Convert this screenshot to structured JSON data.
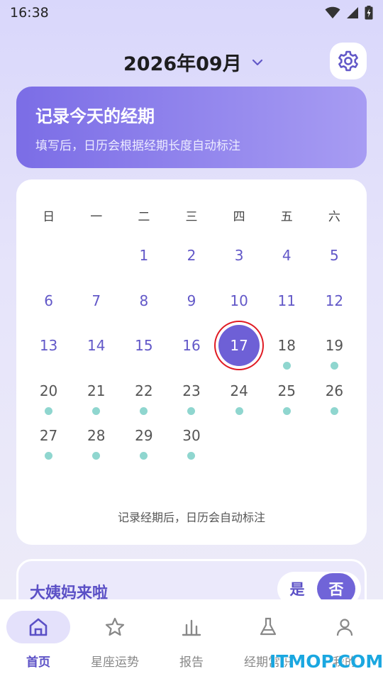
{
  "status_bar": {
    "time": "16:38",
    "icons": [
      "wifi-icon",
      "signal-icon",
      "battery-charging-icon"
    ]
  },
  "header": {
    "month_title": "2026年09月",
    "dropdown_icon": "chevron-down-icon",
    "settings_icon": "gear-icon"
  },
  "banner": {
    "title": "记录今天的经期",
    "subtitle": "填写后，日历会根据经期长度自动标注"
  },
  "calendar": {
    "weekdays": [
      "日",
      "一",
      "二",
      "三",
      "四",
      "五",
      "六"
    ],
    "leading_blanks": 2,
    "days": [
      {
        "n": "1",
        "dot": false
      },
      {
        "n": "2",
        "dot": false
      },
      {
        "n": "3",
        "dot": false
      },
      {
        "n": "4",
        "dot": false
      },
      {
        "n": "5",
        "dot": false
      },
      {
        "n": "6",
        "dot": false
      },
      {
        "n": "7",
        "dot": false
      },
      {
        "n": "8",
        "dot": false
      },
      {
        "n": "9",
        "dot": false
      },
      {
        "n": "10",
        "dot": false
      },
      {
        "n": "11",
        "dot": false
      },
      {
        "n": "12",
        "dot": false
      },
      {
        "n": "13",
        "dot": false
      },
      {
        "n": "14",
        "dot": false
      },
      {
        "n": "15",
        "dot": false
      },
      {
        "n": "16",
        "dot": false
      },
      {
        "n": "17",
        "dot": false,
        "today": true
      },
      {
        "n": "18",
        "dot": true
      },
      {
        "n": "19",
        "dot": true
      },
      {
        "n": "20",
        "dot": true
      },
      {
        "n": "21",
        "dot": true
      },
      {
        "n": "22",
        "dot": true
      },
      {
        "n": "23",
        "dot": true
      },
      {
        "n": "24",
        "dot": true
      },
      {
        "n": "25",
        "dot": true
      },
      {
        "n": "26",
        "dot": true
      },
      {
        "n": "27",
        "dot": true
      },
      {
        "n": "28",
        "dot": true
      },
      {
        "n": "29",
        "dot": true
      },
      {
        "n": "30",
        "dot": true
      }
    ],
    "note": "记录经期后，日历会自动标注",
    "colors": {
      "day_text": "#6258c8",
      "future_text": "#555555",
      "today_bg": "#6e60d6",
      "today_ring": "#e01b24",
      "dot": "#8fd6cf"
    }
  },
  "period_card": {
    "title": "大姨妈来啦",
    "yes_label": "是",
    "no_label": "否",
    "selected": "否"
  },
  "bottom_nav": {
    "items": [
      {
        "label": "首页",
        "icon": "home-icon",
        "active": true
      },
      {
        "label": "星座运势",
        "icon": "star-icon",
        "active": false
      },
      {
        "label": "报告",
        "icon": "bar-chart-icon",
        "active": false
      },
      {
        "label": "经期常识",
        "icon": "flask-icon",
        "active": false
      },
      {
        "label": "我的",
        "icon": "person-icon",
        "active": false
      }
    ]
  },
  "watermark": "ITMOP.COM",
  "accent_color": "#6e60d6"
}
